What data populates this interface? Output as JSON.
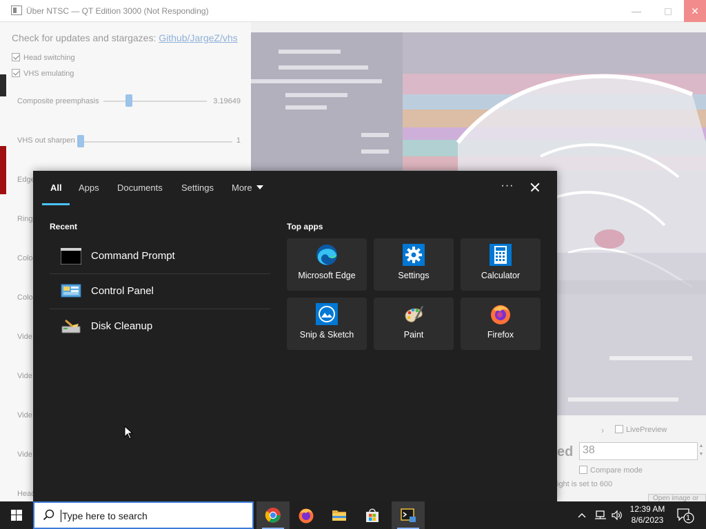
{
  "window": {
    "title": "Über NTSC — QT Edition 3000 (Not Responding)",
    "minimize_glyph": "—",
    "close_glyph": "✕"
  },
  "settings": {
    "updates_text": "Check for updates and stargazes:",
    "updates_link": "Github/JargeZ/vhs",
    "head_switching": "Head switching",
    "vhs_emulating": "VHS emulating",
    "composite_label": "Composite preemphasis",
    "composite_value": "3.19649",
    "composite_fraction": 0.21,
    "sharpen_label": "VHS out sharpen",
    "sharpen_value": "1",
    "sharpen_fraction": 0.0,
    "side_labels": [
      "Edge",
      "Ring",
      "Colo",
      "Colo",
      "Vide",
      "Vide",
      "Vide",
      "Vide",
      "Head"
    ]
  },
  "bottom_panel": {
    "chevron": "›",
    "live_preview": "LivePreview",
    "seed_label_tail": "ed",
    "seed_value": "38",
    "compare_mode": "Compare mode",
    "note": "ight is set to 600",
    "open_button": "Open image or"
  },
  "search_panel": {
    "tabs": [
      "All",
      "Apps",
      "Documents",
      "Settings",
      "More"
    ],
    "more_dots": "···",
    "recent_title": "Recent",
    "recent": [
      {
        "label": "Command Prompt",
        "icon": "command-prompt-icon"
      },
      {
        "label": "Control Panel",
        "icon": "control-panel-icon"
      },
      {
        "label": "Disk Cleanup",
        "icon": "disk-cleanup-icon"
      }
    ],
    "top_apps_title": "Top apps",
    "top_apps": [
      {
        "label": "Microsoft Edge",
        "icon": "edge-icon"
      },
      {
        "label": "Settings",
        "icon": "settings-gear-icon"
      },
      {
        "label": "Calculator",
        "icon": "calculator-icon"
      },
      {
        "label": "Snip & Sketch",
        "icon": "snip-sketch-icon"
      },
      {
        "label": "Paint",
        "icon": "paint-icon"
      },
      {
        "label": "Firefox",
        "icon": "firefox-icon"
      }
    ]
  },
  "taskbar": {
    "search_placeholder": "Type here to search",
    "pinned": [
      "chrome-icon",
      "firefox-icon",
      "file-explorer-icon",
      "microsoft-store-icon",
      "terminal-app-icon"
    ],
    "time": "12:39 AM",
    "date": "8/6/2023",
    "notification_count": "1",
    "accent_color": "#4cc2ff"
  }
}
